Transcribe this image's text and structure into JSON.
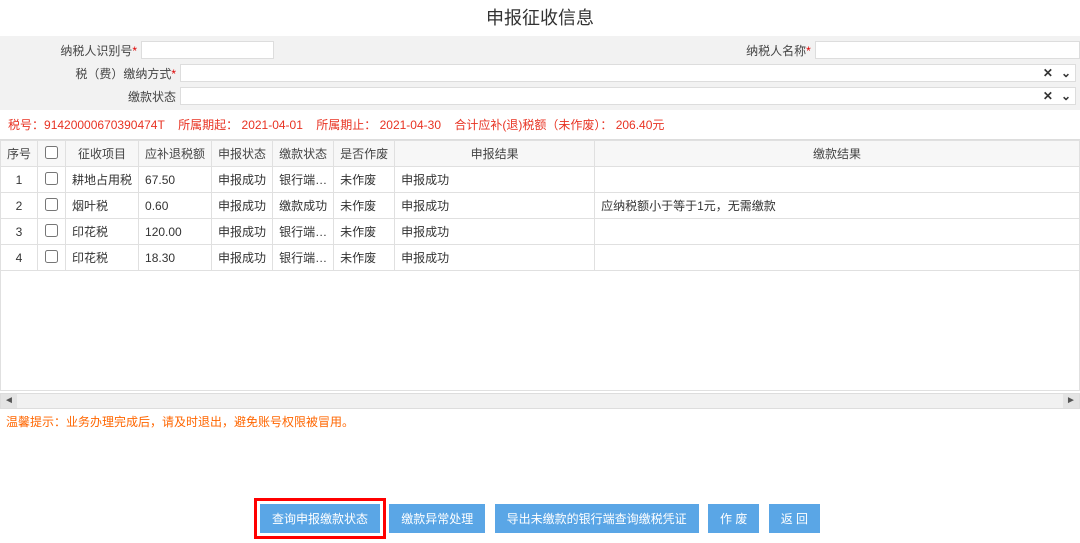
{
  "title": "申报征收信息",
  "form": {
    "taxpayer_id_label": "纳税人识别号",
    "taxpayer_id_value": "",
    "taxpayer_name_label": "纳税人名称",
    "taxpayer_name_value": "",
    "pay_method_label": "税（费）缴纳方式",
    "pay_method_value": "",
    "pay_status_label": "缴款状态",
    "pay_status_value": ""
  },
  "summary": {
    "tax_no_label": "税号：",
    "tax_no": "91420000670390474T",
    "period_start_label": "所属期起：",
    "period_start": "2021-04-01",
    "period_end_label": "所属期止：",
    "period_end": "2021-04-30",
    "total_label": "合计应补(退)税额（未作废）：",
    "total": "206.40元"
  },
  "columns": {
    "seq": "序号",
    "item": "征收项目",
    "amount": "应补退税额",
    "sb_status": "申报状态",
    "jk_status": "缴款状态",
    "voided": "是否作废",
    "sb_result": "申报结果",
    "jk_result": "缴款结果"
  },
  "rows": [
    {
      "seq": "1",
      "item": "耕地占用税",
      "amount": "67.50",
      "sb_status": "申报成功",
      "jk_status": "银行端…",
      "voided": "未作废",
      "sb_result": "申报成功",
      "jk_result": ""
    },
    {
      "seq": "2",
      "item": "烟叶税",
      "amount": "0.60",
      "sb_status": "申报成功",
      "jk_status": "缴款成功",
      "voided": "未作废",
      "sb_result": "申报成功",
      "jk_result": "应纳税额小于等于1元，无需缴款"
    },
    {
      "seq": "3",
      "item": "印花税",
      "amount": "120.00",
      "sb_status": "申报成功",
      "jk_status": "银行端…",
      "voided": "未作废",
      "sb_result": "申报成功",
      "jk_result": ""
    },
    {
      "seq": "4",
      "item": "印花税",
      "amount": "18.30",
      "sb_status": "申报成功",
      "jk_status": "银行端…",
      "voided": "未作废",
      "sb_result": "申报成功",
      "jk_result": ""
    }
  ],
  "tip": "温馨提示：业务办理完成后，请及时退出，避免账号权限被冒用。",
  "buttons": {
    "query": "查询申报缴款状态",
    "exception": "缴款异常处理",
    "export": "导出未缴款的银行端查询缴税凭证",
    "void": "作 废",
    "back": "返 回"
  },
  "icons": {
    "clear": "✕",
    "caret": "⌄",
    "tri_left": "◄",
    "tri_right": "►"
  }
}
